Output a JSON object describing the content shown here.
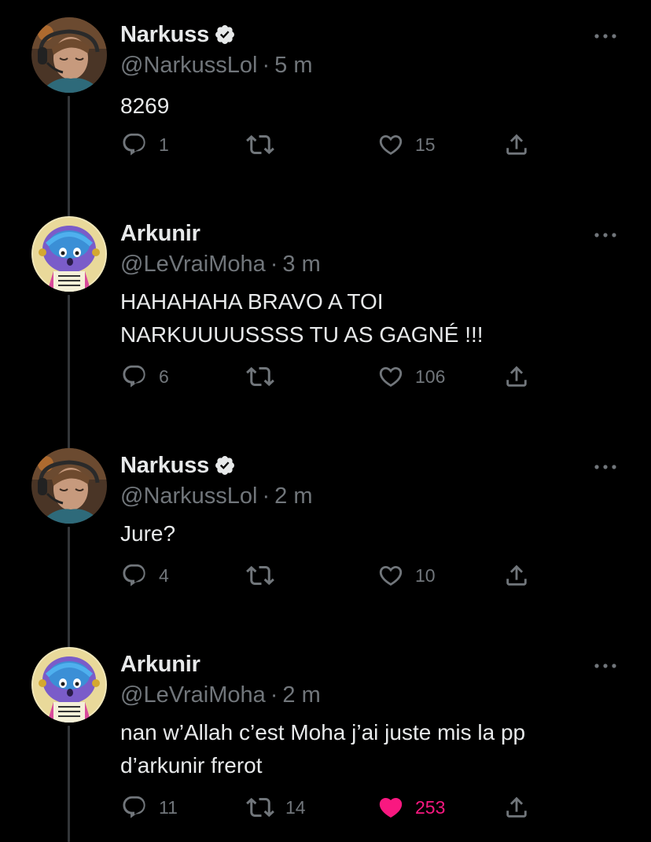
{
  "tweets": [
    {
      "name": "Narkuss",
      "verified": true,
      "handle": "@NarkussLol",
      "separator": "·",
      "time": "5 m",
      "text": "8269",
      "replies": "1",
      "retweets": "",
      "likes": "15",
      "liked": false,
      "avatar": "narkuss-avatar"
    },
    {
      "name": "Arkunir",
      "verified": false,
      "handle": "@LeVraiMoha",
      "separator": "·",
      "time": "3 m",
      "text": "HAHAHAHA BRAVO A TOI NARKUUUUSSSS TU AS GAGNÉ !!!",
      "replies": "6",
      "retweets": "",
      "likes": "106",
      "liked": false,
      "avatar": "arkunir-avatar"
    },
    {
      "name": "Narkuss",
      "verified": true,
      "handle": "@NarkussLol",
      "separator": "·",
      "time": "2 m",
      "text": "Jure?",
      "replies": "4",
      "retweets": "",
      "likes": "10",
      "liked": false,
      "avatar": "narkuss-avatar"
    },
    {
      "name": "Arkunir",
      "verified": false,
      "handle": "@LeVraiMoha",
      "separator": "·",
      "time": "2 m",
      "text": "nan w’Allah c’est Moha j’ai juste mis la pp d’arkunir frerot",
      "replies": "11",
      "retweets": "14",
      "likes": "253",
      "liked": true,
      "avatar": "arkunir-avatar"
    }
  ],
  "colors": {
    "background": "#000000",
    "text": "#e7e9ea",
    "secondary": "#71767b",
    "like_active": "#f91880",
    "thread_line": "#333639"
  },
  "icons": {
    "reply": "reply-icon",
    "retweet": "retweet-icon",
    "like": "heart-icon",
    "share": "share-icon",
    "more": "more-icon",
    "verified": "verified-badge-icon"
  }
}
